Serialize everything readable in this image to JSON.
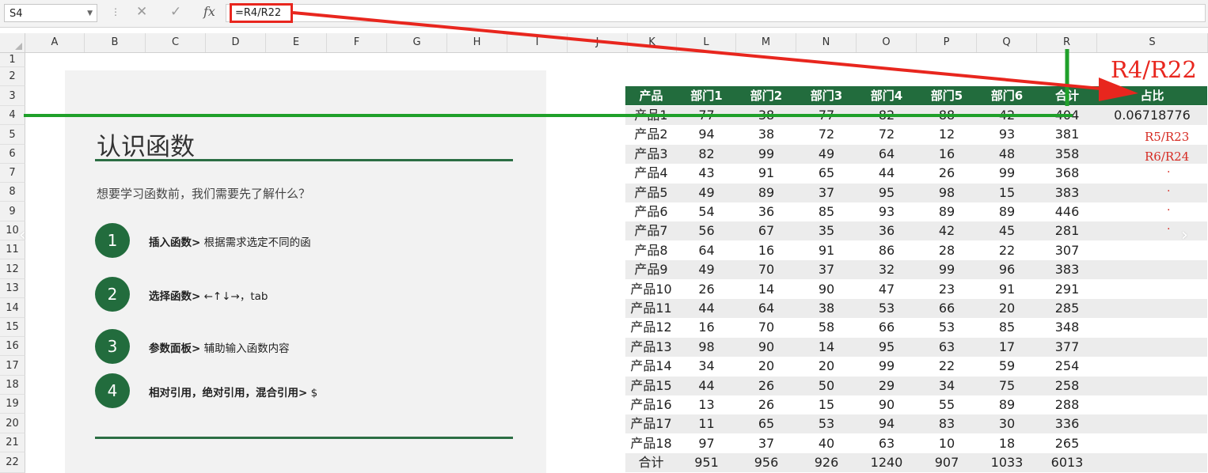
{
  "formula_bar": {
    "name_box": "S4",
    "cancel_icon": "✕",
    "enter_icon": "✓",
    "fx_label": "fx",
    "formula": "=R4/R22"
  },
  "columns": [
    "A",
    "B",
    "C",
    "D",
    "E",
    "F",
    "G",
    "H",
    "I",
    "J",
    "K",
    "L",
    "M",
    "N",
    "O",
    "P",
    "Q",
    "R",
    "S"
  ],
  "rows": [
    "1",
    "2",
    "3",
    "4",
    "5",
    "6",
    "7",
    "8",
    "9",
    "10",
    "11",
    "12",
    "13",
    "14",
    "15",
    "16",
    "17",
    "18",
    "19",
    "20",
    "21",
    "22"
  ],
  "slide": {
    "title": "认识函数",
    "subtitle": "想要学习函数前，我们需要先了解什么？",
    "items": [
      {
        "num": "1",
        "bold": "插入函数>",
        "text": " 根据需求选定不同的函"
      },
      {
        "num": "2",
        "bold": "选择函数>",
        "text": " ←↑↓→，tab"
      },
      {
        "num": "3",
        "bold": "参数面板>",
        "text": " 辅助输入函数内容"
      },
      {
        "num": "4",
        "bold": "相对引用，绝对引用，混合引用>",
        "text": " $"
      }
    ]
  },
  "table": {
    "headers": [
      "产品",
      "部门1",
      "部门2",
      "部门3",
      "部门4",
      "部门5",
      "部门6",
      "合计",
      "占比"
    ],
    "rows": [
      [
        "产品1",
        "77",
        "38",
        "77",
        "82",
        "88",
        "42",
        "404",
        "0.06718776"
      ],
      [
        "产品2",
        "94",
        "38",
        "72",
        "72",
        "12",
        "93",
        "381",
        ""
      ],
      [
        "产品3",
        "82",
        "99",
        "49",
        "64",
        "16",
        "48",
        "358",
        ""
      ],
      [
        "产品4",
        "43",
        "91",
        "65",
        "44",
        "26",
        "99",
        "368",
        ""
      ],
      [
        "产品5",
        "49",
        "89",
        "37",
        "95",
        "98",
        "15",
        "383",
        ""
      ],
      [
        "产品6",
        "54",
        "36",
        "85",
        "93",
        "89",
        "89",
        "446",
        ""
      ],
      [
        "产品7",
        "56",
        "67",
        "35",
        "36",
        "42",
        "45",
        "281",
        ""
      ],
      [
        "产品8",
        "64",
        "16",
        "91",
        "86",
        "28",
        "22",
        "307",
        ""
      ],
      [
        "产品9",
        "49",
        "70",
        "37",
        "32",
        "99",
        "96",
        "383",
        ""
      ],
      [
        "产品10",
        "26",
        "14",
        "90",
        "47",
        "23",
        "91",
        "291",
        ""
      ],
      [
        "产品11",
        "44",
        "64",
        "38",
        "53",
        "66",
        "20",
        "285",
        ""
      ],
      [
        "产品12",
        "16",
        "70",
        "58",
        "66",
        "53",
        "85",
        "348",
        ""
      ],
      [
        "产品13",
        "98",
        "90",
        "14",
        "95",
        "63",
        "17",
        "377",
        ""
      ],
      [
        "产品14",
        "34",
        "20",
        "20",
        "99",
        "22",
        "59",
        "254",
        ""
      ],
      [
        "产品15",
        "44",
        "26",
        "50",
        "29",
        "34",
        "75",
        "258",
        ""
      ],
      [
        "产品16",
        "13",
        "26",
        "15",
        "90",
        "55",
        "89",
        "288",
        ""
      ],
      [
        "产品17",
        "11",
        "65",
        "53",
        "94",
        "83",
        "30",
        "336",
        ""
      ],
      [
        "产品18",
        "97",
        "37",
        "40",
        "63",
        "10",
        "18",
        "265",
        ""
      ],
      [
        "合计",
        "951",
        "956",
        "926",
        "1240",
        "907",
        "1033",
        "6013",
        ""
      ]
    ]
  },
  "annotations": {
    "big": "R4/R22",
    "r5": "R5/R23",
    "r6": "R6/R24",
    "dot": "·"
  },
  "nav": {
    "prev": "‹",
    "next": "›"
  },
  "colors": {
    "accent_green": "#226c3d",
    "annotation_red": "#e8261e",
    "guide_green": "#1fa02a"
  }
}
